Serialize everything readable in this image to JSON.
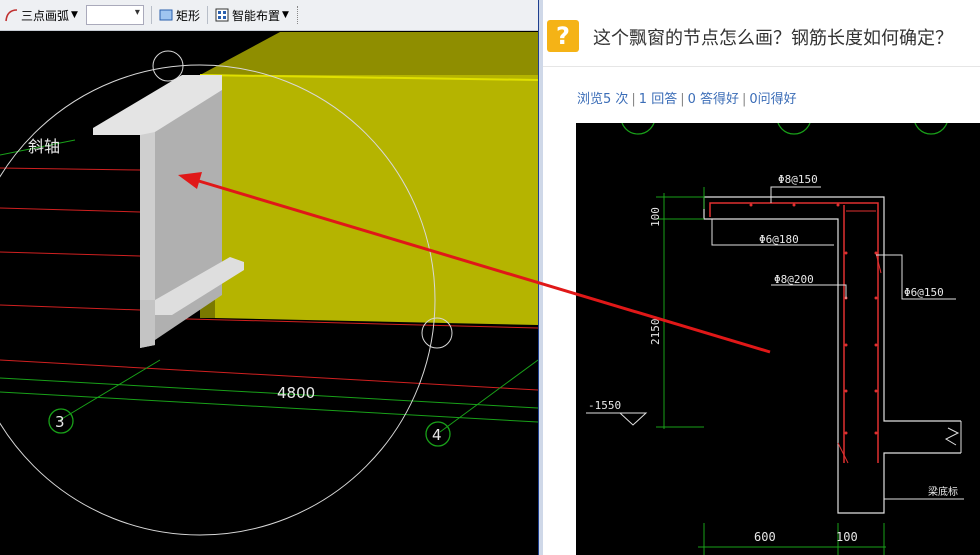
{
  "toolbar": {
    "arc_tool": "三点画弧",
    "rect_tool": "矩形",
    "smart_layout": "智能布置"
  },
  "cad": {
    "axis_label": "斜轴",
    "dimension": "4800",
    "grid_bubbles": [
      "3",
      "4"
    ],
    "colors": {
      "wall": "#b5b400",
      "beam": "#c8c8c8"
    }
  },
  "question": {
    "icon": "?",
    "title": "这个飘窗的节点怎么画？钢筋长度如何确定？",
    "stats": {
      "views": "浏览5 次",
      "answers": "1 回答",
      "good_answers": "0 答得好",
      "good_questions": "0问得好"
    }
  },
  "drawing": {
    "rebar_top": "Φ8@150",
    "rebar_stirrup_top": "Φ6@180",
    "rebar_mid": "Φ8@200",
    "rebar_right": "Φ6@150",
    "dim_100_top": "100",
    "dim_2150": "2150",
    "elevation": "-1550",
    "dim_600": "600",
    "dim_100_bottom": "100",
    "beam_label": "梁底标"
  }
}
